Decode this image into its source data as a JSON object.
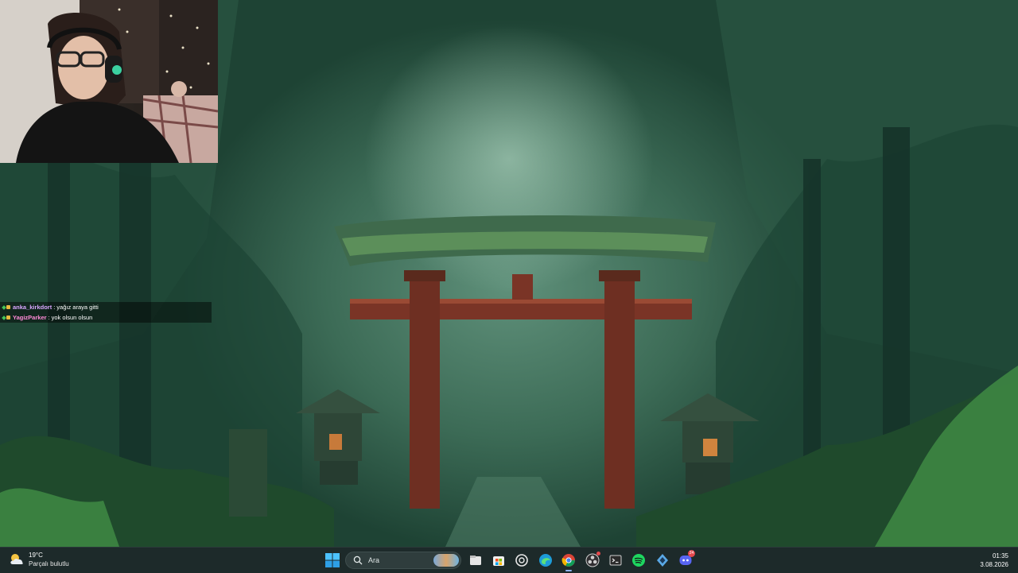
{
  "chat": {
    "messages": [
      {
        "user": "anka_kirkdort",
        "text": "yağız araya gitti",
        "user_color": "#d9a6ff"
      },
      {
        "user": "YagizParker",
        "text": "yok olsun olsun",
        "user_color": "#ff8ad8"
      }
    ]
  },
  "taskbar": {
    "weather": {
      "temp": "19°C",
      "desc": "Parçalı bulutlu"
    },
    "search": {
      "placeholder": "Ara"
    },
    "apps": [
      {
        "name": "file-explorer-icon"
      },
      {
        "name": "microsoft-store-icon"
      },
      {
        "name": "chatgpt-icon"
      },
      {
        "name": "edge-icon"
      },
      {
        "name": "chrome-icon"
      },
      {
        "name": "obs-icon"
      },
      {
        "name": "terminal-icon"
      },
      {
        "name": "spotify-icon"
      },
      {
        "name": "app-icon"
      },
      {
        "name": "discord-icon",
        "badge": "24"
      }
    ],
    "clock": {
      "time": "01:35",
      "date": "3.08.2026"
    }
  },
  "colors": {
    "taskbar_bg": "#1d2a2a",
    "accent": "#8fb5ff",
    "torii_red": "#8a3a28"
  }
}
